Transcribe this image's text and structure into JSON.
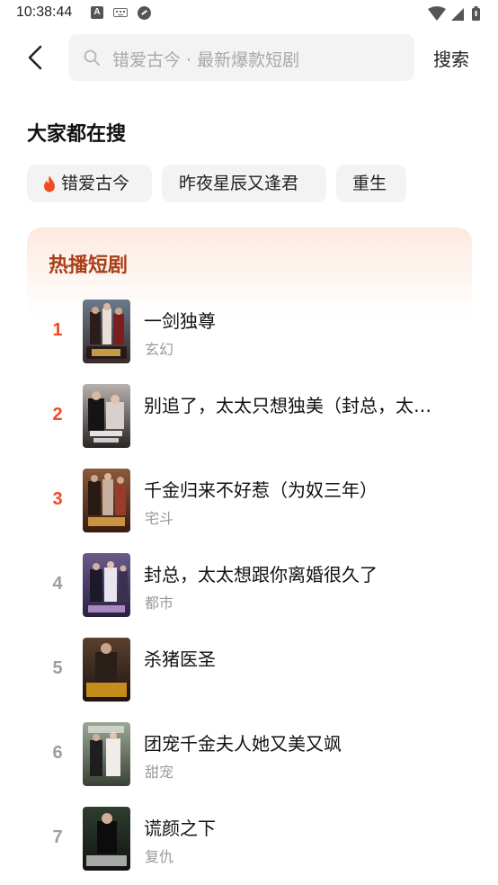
{
  "status_bar": {
    "time": "10:38:44",
    "a_icon_letter": "A"
  },
  "search": {
    "placeholder": "错爱古今 · 最新爆款短剧",
    "button_label": "搜索"
  },
  "hot_searches": {
    "title": "大家都在搜",
    "chips": [
      "错爱古今",
      "昨夜星辰又逢君",
      "重生"
    ]
  },
  "hot_list": {
    "title": "热播短剧",
    "items": [
      {
        "rank": "1",
        "title": "一剑独尊",
        "genre": "玄幻"
      },
      {
        "rank": "2",
        "title": "别追了，太太只想独美（封总，太…",
        "genre": ""
      },
      {
        "rank": "3",
        "title": "千金归来不好惹（为奴三年）",
        "genre": "宅斗"
      },
      {
        "rank": "4",
        "title": "封总，太太想跟你离婚很久了",
        "genre": "都市"
      },
      {
        "rank": "5",
        "title": "杀猪医圣",
        "genre": ""
      },
      {
        "rank": "6",
        "title": "团宠千金夫人她又美又飒",
        "genre": "甜宠"
      },
      {
        "rank": "7",
        "title": "谎颜之下",
        "genre": "复仇"
      }
    ]
  },
  "colors": {
    "top_rank": "#f04b23",
    "normal_rank": "#9e9e9e",
    "card_title": "#a8401a",
    "flame": "#f04b23"
  },
  "icons": [
    "back-arrow-icon",
    "search-icon",
    "flame-icon",
    "wifi-icon",
    "signal-icon",
    "battery-icon",
    "keyboard-icon",
    "cast-icon"
  ]
}
